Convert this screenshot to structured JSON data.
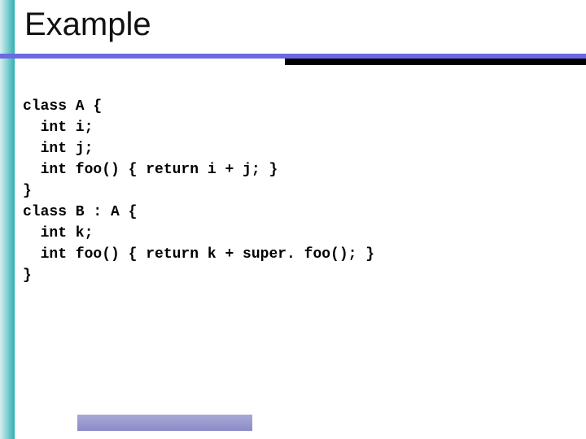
{
  "slide": {
    "title": "Example",
    "code_lines": [
      "class A {",
      "  int i;",
      "  int j;",
      "  int foo() { return i + j; }",
      "}",
      "class B : A {",
      "  int k;",
      "  int foo() { return k + super. foo(); }",
      "}"
    ]
  }
}
